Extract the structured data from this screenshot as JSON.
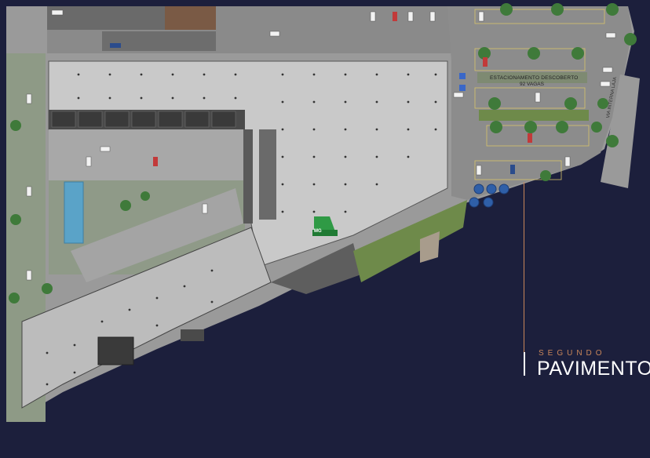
{
  "plan": {
    "parking_title": "ESTACIONAMENTO DESCOBERTO",
    "parking_count": "92 VAGAS",
    "road_label": "VIA INTERNA LAJA",
    "logo_text": "MG"
  },
  "callout": {
    "subtitle": "SEGUNDO",
    "title": "PAVIMENTO"
  },
  "colors": {
    "background": "#1c1f3c",
    "accent": "#c9865a",
    "roof": "#c9c9c9",
    "asphalt": "#8c8c8c",
    "grass": "#6e8a4a",
    "pool": "#5aa3c8"
  }
}
